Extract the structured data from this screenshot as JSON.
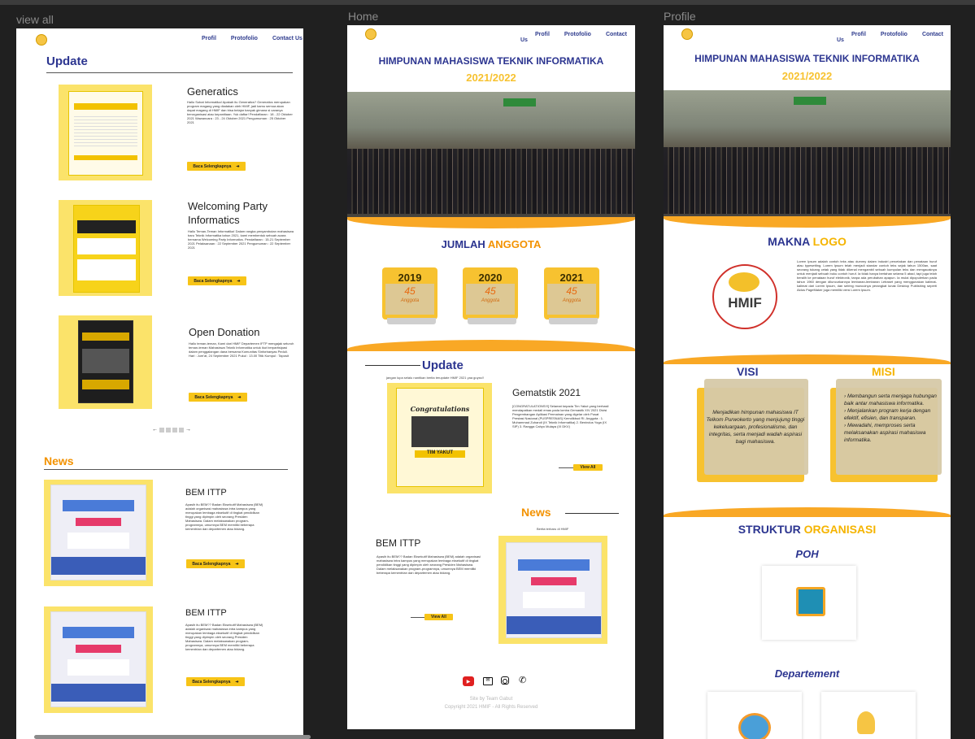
{
  "frames": {
    "view_all": {
      "label": "view all"
    },
    "home": {
      "label": "Home"
    },
    "profile": {
      "label": "Profile"
    }
  },
  "nav": {
    "profil": "Profil",
    "protofolio": "Protofolio",
    "contact": "Contact Us"
  },
  "view_all": {
    "update_heading": "Update",
    "news_heading": "News",
    "updates": [
      {
        "title": "Generatics",
        "text": "Hallo Sobat Informatika! Apakah itu Generatics? Generatics merupakan program magang yang diadakan oleh HMIF, jadi kamu semua akan dapat magang di HMIF dan bisa belajar banyak gimana si caranya berorganisasi atau kepanitiaan. Yuk daftar! Pendaftaran : 18 - 22 Oktober 2021 Wawancara : 23 - 24 Oktober 2021 Pengumuman : 25 Oktober 2021",
        "button": "Baca Selengkapnya"
      },
      {
        "title": "Welcoming Party Informatics",
        "text": "Hallo Teman-Teman Informatika! Dalam rangka penyambutan mahasiswa baru Teknik Informatika tahun 2021, kami membentuk sebuah acara bernama Welcoming Party Informatics. Pendaftaran : 15-21 September 2021 Pelaksanaan : 22 September 2021 Pengumuman : 22 September 2021",
        "button": "Baca Selengkapnya"
      },
      {
        "title": "Open Donation",
        "text": "Hallo teman-teman, Kami dari HMIF Departemen IFTP mengajak seluruh teman-teman Mahasiswa Teknik Informatika untuk ikut berpartisipasi dalam penggalangan dana bersama Komunitas Sinforbanyas Peduli. Hari : Jum'at, 24 September 2021 Pukul : 13.00 Titik Kumpul : Taposit",
        "button": "Baca Selengkapnya"
      }
    ],
    "news": [
      {
        "title": "BEM ITTP",
        "text": "Apasih itu BEM?? Badan Eksekutif Mahasiswa (BEM) adalah organisasi mahasiswa intra kampus yang merupakan lembaga eksekutif di tingkat pendidikan tinggi yang dipimpin oleh seorang Presiden Mahasiswa. Dalam melaksanakan program-programnya, umumnya BEM memiliki beberapa kementrian dan departemen atau bidang.",
        "button": "Baca Selengkapnya"
      },
      {
        "title": "BEM ITTP",
        "text": "Apasih itu BEM?? Badan Eksekutif Mahasiswa (BEM) adalah organisasi mahasiswa intra kampus yang merupakan lembaga eksekutif di tingkat pendidikan tinggi yang dipimpin oleh seorang Presiden Mahasiswa. Dalam melaksanakan program-programnya, umumnya BEM memiliki beberapa kementrian dan departemen atau bidang.",
        "button": "Baca Selengkapnya"
      }
    ],
    "pager_prev": "←",
    "pager_next": "→"
  },
  "home": {
    "hero_title": "HIMPUNAN MAHASISWA TEKNIK INFORMATIKA",
    "hero_year": "2021/2022",
    "jumlah_a": "JUMLAH",
    "jumlah_b": "ANGGOTA",
    "members": [
      {
        "year": "2019",
        "count": "45",
        "label": "Anggota"
      },
      {
        "year": "2020",
        "count": "45",
        "label": "Anggota"
      },
      {
        "year": "2021",
        "count": "45",
        "label": "Anggota"
      }
    ],
    "update_heading": "Update",
    "update_sub": "jangan lupa selalu nantikan berita terupdate HMIF 2021 yaa guyss!!",
    "update_title": "Gematstik 2021",
    "update_text": "[CONGRATULATIONS!!!] Selamat kepada Tim Yakut yang berhasil mendapatkan medali emas pada lomba Gemastik XIV 2021 Divisi Pengembangan Aplikasi Permainan yang digelar oleh Pusat Prestasi Nasional (PUSPRESNAS) Kemdikbud RI. Anggota : 1. Muhammad Zuhandi (IX Teknik Informatika) 2. Benindus Yoga (IX SIP) 3. Rangga Cahyo Mulaya (IX DKV)",
    "update_view": "View All",
    "poster_congrats": "Congratulations",
    "poster_team": "TIM YAKUT",
    "news_heading": "News",
    "news_sub": "Berita terbaru di HMIF",
    "news_title": "BEM ITTP",
    "news_text": "Apasih itu BEM?? Badan Eksekutif Mahasiswa (BEM) adalah organisasi mahasiswa intra kampus yang merupakan lembaga eksekutif di tingkat pendidikan tinggi yang dipimpin oleh seorang Presiden Mahasiswa. Dalam melaksanakan program-programnya, umumnya BEM memiliki beberapa kementrian dan departemen atau bidang.",
    "news_view": "View All",
    "footer_site": "Site by Team Gabut",
    "footer_copy": "Copyright 2021 HMIF - All Rights Reserved"
  },
  "profile": {
    "hero_title": "HIMPUNAN MAHASISWA TEKNIK INFORMATIKA",
    "hero_year": "2021/2022",
    "makna_a": "MAKNA",
    "makna_b": "LOGO",
    "makna_text": "Lorem Ipsum adalah contoh teks atau dummy dalam industri percetakan dan penataan huruf atau typesetting. Lorem Ipsum telah menjadi standar contoh teks sejak tahun 1500an, saat seorang tukang cetak yang tidak dikenal mengambil sebuah kumpulan teks dan mengacaknya untuk menjadi sebuah buku contoh huruf. Ia tidak hanya bertahan selama 5 abad, tapi juga telah beralih ke penataan huruf elektronik, tanpa ada perubahan apapun. Ia mulai dipopulerkan pada tahun 1960 dengan diluncurkannya lembaran-lembaran Letraset yang menggunakan kalimat-kalimat dari Lorem Ipsum, dan seiring munculnya perangkat lunak Desktop Publishing seperti Aldus PageMaker juga memiliki versi Lorem Ipsum.",
    "logo_text": "HMIF",
    "visi_heading": "VISI",
    "misi_heading": "MISI",
    "visi_text": "Menjadikan himpunan mahasiswa IT Telkom Purwokerto yang menjujung tinggi kekeluargaan, profesionalisme, dan integritas, serta menjadi wadah aspirasi bagi mahasiswa.",
    "misi": [
      "Membangun serta menjaga hubungan baik antar mahasiswa informatika.",
      "Menjalankan program kerja dengan efektif, efisien, dan transparan.",
      "Mewadahi, memproses serta melaksanakan aspirasi mahasiswa informatika."
    ],
    "struktur_a": "STRUKTUR",
    "struktur_b": "ORGANISASI",
    "poh": "POH",
    "departement": "Departement"
  },
  "colors": {
    "navy": "#2c3590",
    "yellow": "#f5b400",
    "orange": "#f39200",
    "poster": "#fbe36a"
  },
  "icons": [
    "hmif-logo-icon",
    "arrow-right-icon",
    "youtube-icon",
    "mail-icon",
    "instagram-icon",
    "phone-icon",
    "chip-icon",
    "brain-gear-icon",
    "lightbulb-icon"
  ]
}
